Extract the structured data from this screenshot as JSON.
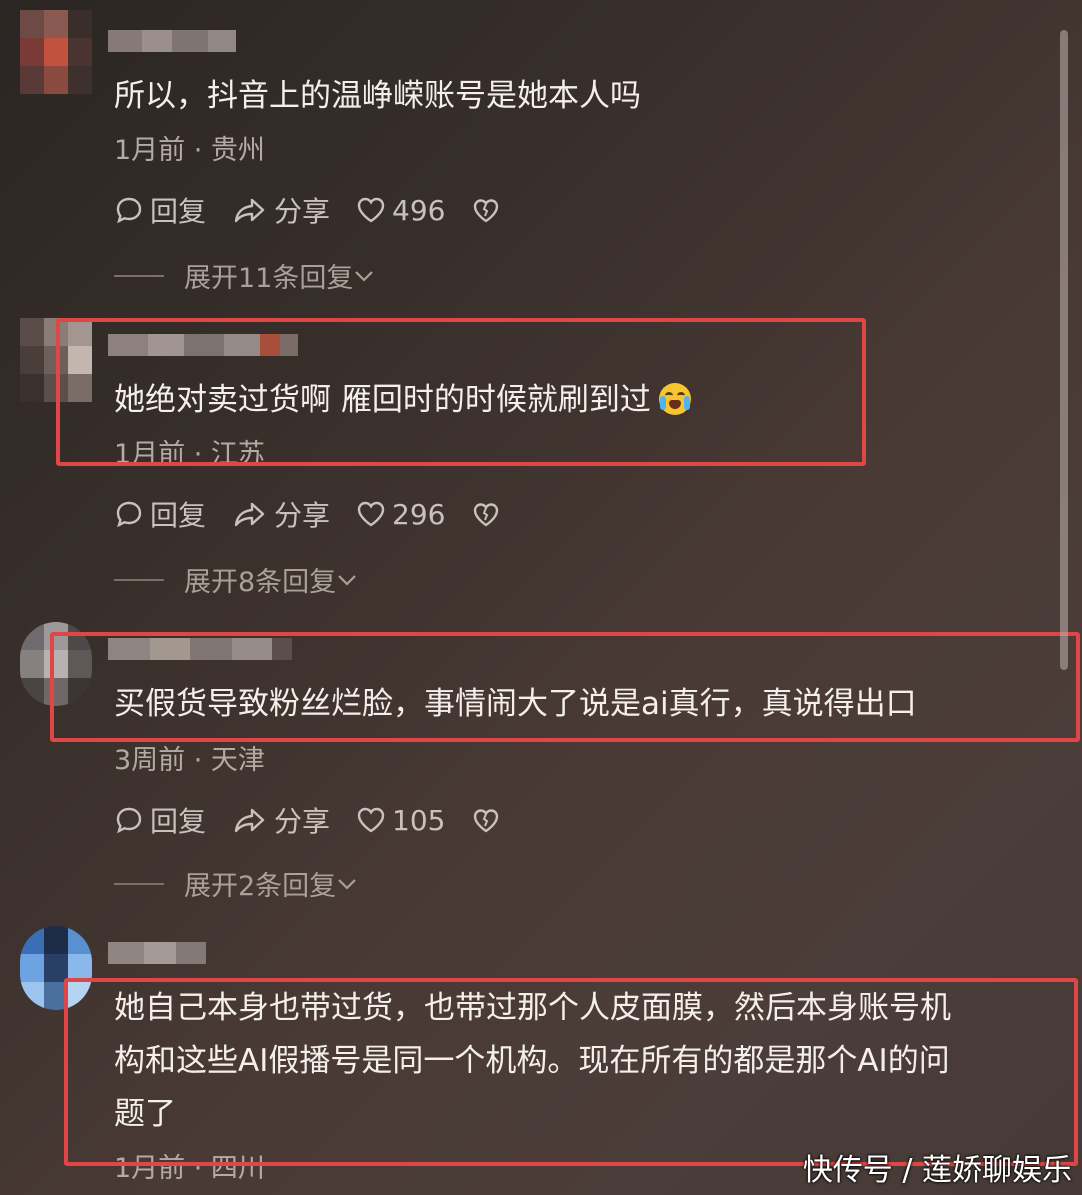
{
  "comments": [
    {
      "text": "所以，抖音上的温峥嵘账号是她本人吗",
      "meta": "1月前 · 贵州",
      "reply_label": "回复",
      "share_label": "分享",
      "likes": "496",
      "expand": "展开11条回复"
    },
    {
      "text": "她绝对卖过货啊 雁回时的时候就刷到过",
      "emoji": "crying-laughing-emoji",
      "meta": "1月前 · 江苏",
      "reply_label": "回复",
      "share_label": "分享",
      "likes": "296",
      "expand": "展开8条回复"
    },
    {
      "text": "买假货导致粉丝烂脸，事情闹大了说是ai真行，真说得出口",
      "meta": "3周前 · 天津",
      "reply_label": "回复",
      "share_label": "分享",
      "likes": "105",
      "expand": "展开2条回复"
    },
    {
      "text_lines": [
        "她自己本身也带过货，也带过那个人皮面膜，然后本身账号机",
        "构和这些AI假播号是同一个机构。现在所有的都是那个AI的问",
        "题了"
      ],
      "meta": "1月前 · 四川"
    }
  ],
  "watermark": "快传号 / 莲娇聊娱乐",
  "colors": {
    "highlight": "#e04646",
    "background": "#3a302c"
  },
  "icons": {
    "reply": "comment-bubble-icon",
    "share": "share-arrow-icon",
    "like": "heart-icon",
    "dislike": "broken-heart-icon",
    "expand": "chevron-down-icon"
  }
}
